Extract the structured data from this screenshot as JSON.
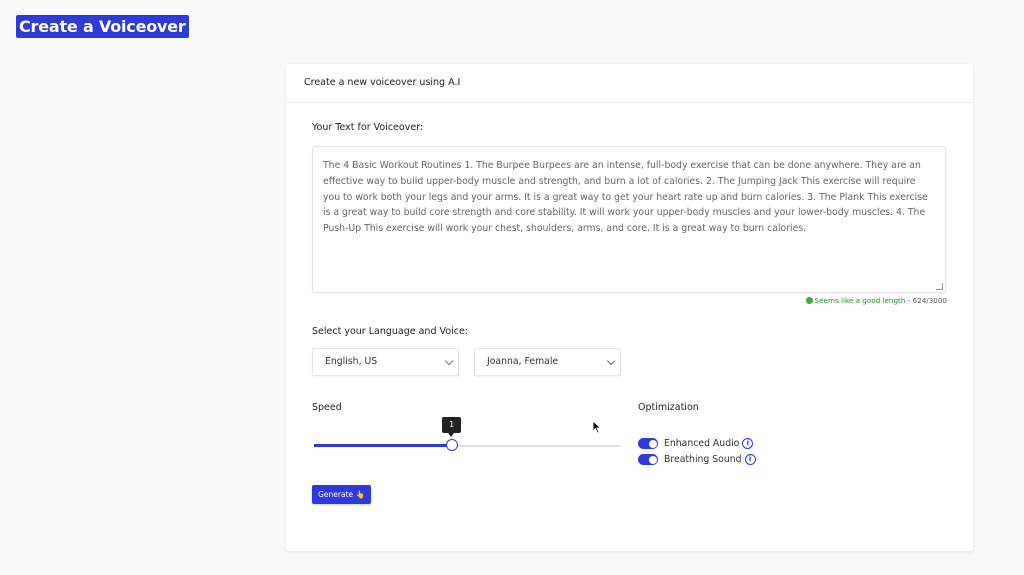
{
  "page_title": "Create a Voiceover",
  "card": {
    "header": "Create a new voiceover using A.I",
    "text_label": "Your Text for Voiceover:",
    "text_value": "The 4 Basic Workout Routines 1. The Burpee Burpees are an intense, full-body exercise that can be done anywhere. They are an effective way to build upper-body muscle and strength, and burn a lot of calories. 2. The Jumping Jack This exercise will require you to work both your legs and your arms. It is a great way to get your heart rate up and burn calories. 3. The Plank This exercise is a great way to build core strength and core stability. It will work your upper-body muscles and your lower-body muscles. 4. The Push-Up This exercise will work your chest, shoulders, arms, and core. It is a great way to burn calories.",
    "length_status": "Seems like a good length",
    "length_count": " - 624/3000",
    "language_label": "Select your Language and Voice:",
    "language_value": "English, US",
    "voice_value": "Joanna, Female",
    "speed_label": "Speed",
    "speed_value": "1",
    "speed_fraction": 0.45,
    "optimization_label": "Optimization",
    "enhanced_audio_label": "Enhanced Audio",
    "breathing_sound_label": "Breathing Sound",
    "info_glyph": "i",
    "generate_label": "Generate 👆"
  },
  "colors": {
    "accent": "#2f3bd8",
    "good": "#2e8a35"
  }
}
